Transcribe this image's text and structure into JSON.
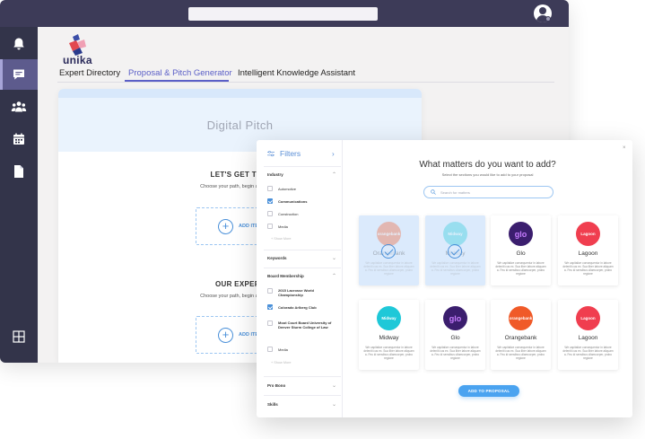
{
  "app": {
    "brand": "unika",
    "nav_tabs": [
      {
        "label": "Expert Directory"
      },
      {
        "label": "Proposal & Pitch Generator"
      },
      {
        "label": "Intelligent Knowledge Assistant"
      }
    ]
  },
  "pitch": {
    "title": "Digital Pitch",
    "sections": [
      {
        "title": "LET'S GET TO P",
        "subtitle": "Choose your path, begin a pursuit, o",
        "add_label": "ADD ITE"
      },
      {
        "title": "OUR EXPERT",
        "subtitle": "Choose your path, begin a pursuit, o",
        "add_label": "ADD ITE"
      }
    ]
  },
  "filters": {
    "title": "Filters",
    "industry": {
      "label": "Industry",
      "options": [
        {
          "label": "Automotive",
          "checked": false
        },
        {
          "label": "Communications",
          "checked": true
        },
        {
          "label": "Construction",
          "checked": false
        },
        {
          "label": "Media",
          "checked": false
        }
      ],
      "show_more": "+ Show More"
    },
    "keywords": {
      "label": "Keywords"
    },
    "board_membership": {
      "label": "Board Membership",
      "options": [
        {
          "label": "2015 Lacrosse World Championship",
          "checked": false
        },
        {
          "label": "Colorado Arlberg Club",
          "checked": true
        },
        {
          "label": "Moot Court Board University of Denver Sturm College of Law",
          "checked": false
        },
        {
          "label": "Media",
          "checked": false
        }
      ],
      "show_more": "+ Show More"
    },
    "pro_bono": {
      "label": "Pro Bono"
    },
    "skills": {
      "label": "Skills"
    }
  },
  "modal": {
    "title": "What matters do you want to add?",
    "subtitle": "Select the sections you would like to add to your proposal",
    "search_placeholder": "Search for matters",
    "add_button": "ADD TO PROPOSAL",
    "close": "×",
    "tiles": [
      {
        "name": "Orangebank",
        "logo_text": "orangebank",
        "color": "#f05a28",
        "selected": true,
        "desc": "We capitalize consequentur in labore deleniti cus ex. Sua liber labore aliquam a. Feu id sensibus ullamcorper, probo regione"
      },
      {
        "name": "Midway",
        "logo_text": "Midway",
        "color": "#1fc8d8",
        "selected": true,
        "desc": "We capitalize consequentur in labore deleniti cus ex. Sua liber labore aliquam a. Feu id sensibus ullamcorper, probo regione"
      },
      {
        "name": "Glo",
        "logo_text": "glo",
        "color": "#3b1e6e",
        "selected": false,
        "desc": "We capitalize consequentur in labore deleniti cus ex. Sua liber labore aliquam a. Feu id sensibus ullamcorper, probo regione"
      },
      {
        "name": "Lagoon",
        "logo_text": "Lagoon",
        "color": "#f03e4f",
        "selected": false,
        "desc": "We capitalize consequentur in labore deleniti cus ex. Sua liber labore aliquam a. Feu id sensibus ullamcorper, probo regione"
      },
      {
        "name": "Midway",
        "logo_text": "Midway",
        "color": "#1fc8d8",
        "selected": false,
        "desc": "We capitalize consequentur in labore deleniti cus ex. Sua liber labore aliquam a. Feu id sensibus ullamcorper, probo regione"
      },
      {
        "name": "Glo",
        "logo_text": "glo",
        "color": "#3b1e6e",
        "selected": false,
        "desc": "We capitalize consequentur in labore deleniti cus ex. Sua liber labore aliquam a. Feu id sensibus ullamcorper, probo regione"
      },
      {
        "name": "Orangebank",
        "logo_text": "orangebank",
        "color": "#f05a28",
        "selected": false,
        "desc": "We capitalize consequentur in labore deleniti cus ex. Sua liber labore aliquam a. Feu id sensibus ullamcorper, probo regione"
      },
      {
        "name": "Lagoon",
        "logo_text": "Lagoon",
        "color": "#f03e4f",
        "selected": false,
        "desc": "We capitalize consequentur in labore deleniti cus ex. Sua liber labore aliquam a. Feu id sensibus ullamcorper, probo regione"
      }
    ]
  },
  "icons": {
    "rail": [
      "bell-icon",
      "chat-icon",
      "teams-icon",
      "calendar-icon",
      "files-icon",
      "apps-icon"
    ]
  },
  "colors": {
    "topbar": "#3d3b58",
    "rail": "#33344a",
    "rail_active": "#5d5b8d",
    "accent": "#5b5fc7",
    "primary_blue": "#4a90d9"
  }
}
